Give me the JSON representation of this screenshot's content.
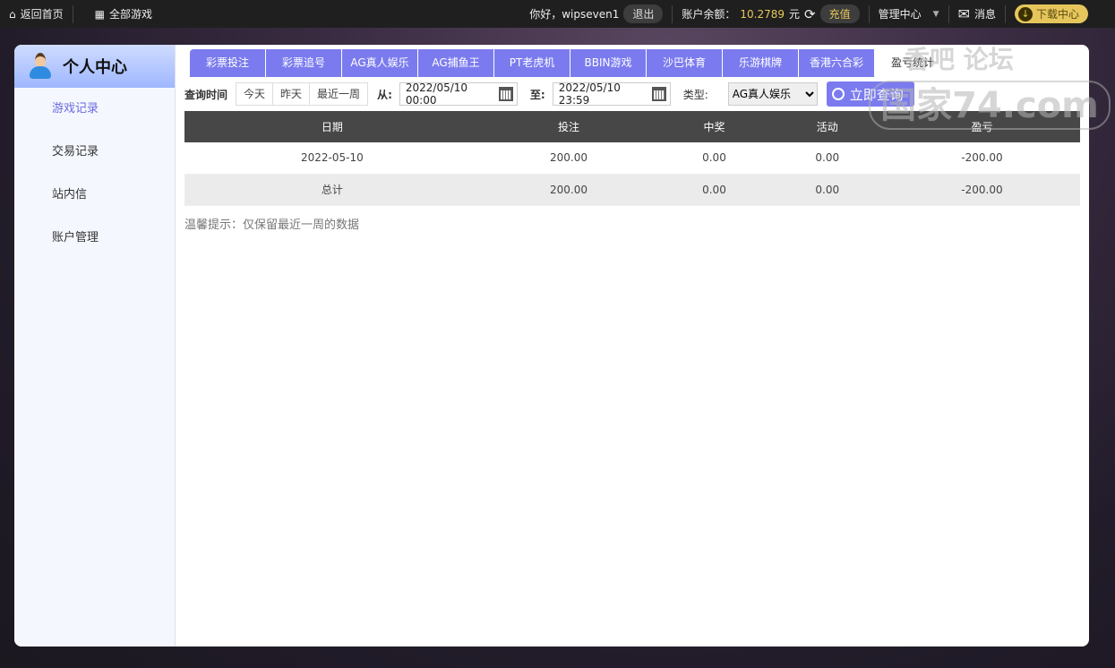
{
  "topbar": {
    "home": "返回首页",
    "all_games": "全部游戏",
    "greeting": "你好，wipseven1",
    "logout": "退出",
    "balance_label": "账户余额：",
    "balance": "10.2789",
    "currency": "元",
    "recharge": "充值",
    "admin": "管理中心",
    "messages": "消息",
    "download": "下载中心"
  },
  "sidebar": {
    "title": "个人中心",
    "items": [
      {
        "label": "游戏记录"
      },
      {
        "label": "交易记录"
      },
      {
        "label": "站内信"
      },
      {
        "label": "账户管理"
      }
    ]
  },
  "tabs": [
    {
      "label": "彩票投注"
    },
    {
      "label": "彩票追号"
    },
    {
      "label": "AG真人娱乐"
    },
    {
      "label": "AG捕鱼王"
    },
    {
      "label": "PT老虎机"
    },
    {
      "label": "BBIN游戏"
    },
    {
      "label": "沙巴体育"
    },
    {
      "label": "乐游棋牌"
    },
    {
      "label": "香港六合彩"
    },
    {
      "label": "盈亏统计"
    }
  ],
  "filters": {
    "label": "查询时间",
    "today": "今天",
    "yesterday": "昨天",
    "week": "最近一周",
    "from_label": "从:",
    "from": "2022/05/10 00:00",
    "to_label": "至:",
    "to": "2022/05/10 23:59",
    "type_label": "类型:",
    "type": "AG真人娱乐",
    "search": "立即查询"
  },
  "table": {
    "headers": [
      "日期",
      "投注",
      "中奖",
      "活动",
      "盈亏"
    ],
    "rows": [
      [
        "2022-05-10",
        "200.00",
        "0.00",
        "0.00",
        "-200.00"
      ]
    ],
    "total": [
      "总计",
      "200.00",
      "0.00",
      "0.00",
      "-200.00"
    ]
  },
  "tip": "温馨提示：仅保留最近一周的数据",
  "watermark": {
    "top": "香吧 论坛",
    "bottom": "国家74.com"
  }
}
